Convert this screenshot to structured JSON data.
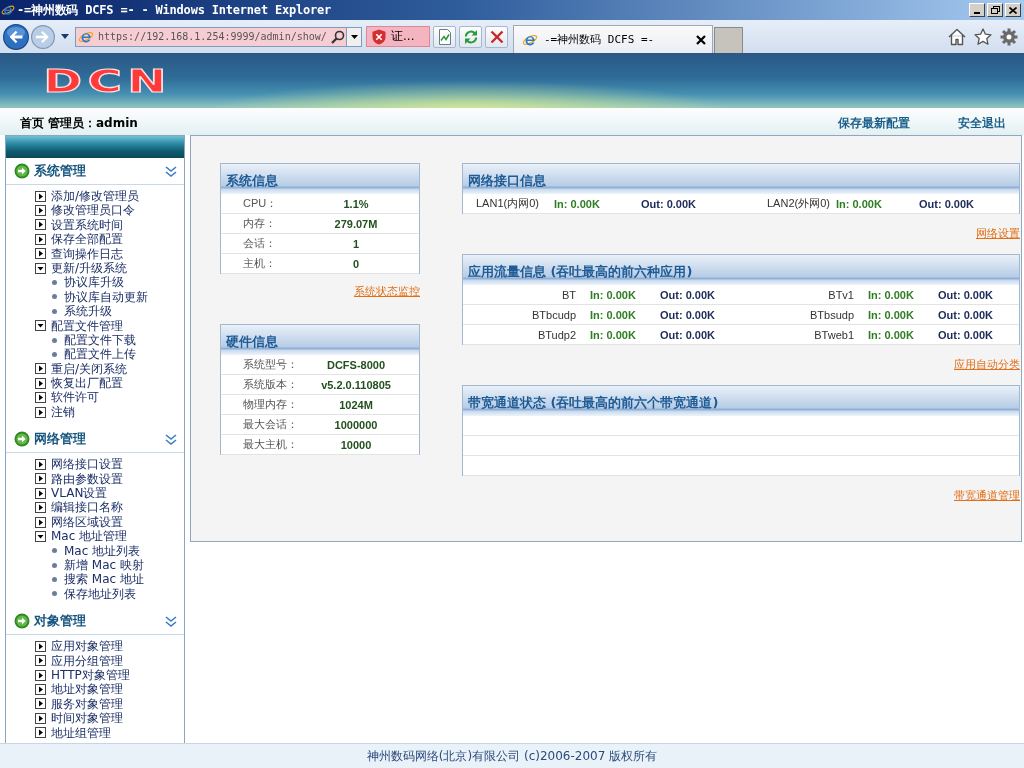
{
  "window": {
    "title": "-=神州数码 DCFS =- - Windows Internet Explorer"
  },
  "browser": {
    "address": "https://192.168.1.254:9999/admin/show/",
    "certificate": "证...",
    "tabs": [
      {
        "label": "-=神州数码 DCFS =-",
        "selected": true
      }
    ]
  },
  "header": {
    "logo": "DCN",
    "home": "首页",
    "admin": "管理员：admin",
    "links": [
      "保存最新配置",
      "安全退出"
    ]
  },
  "sidebar": {
    "sections": [
      {
        "title": "系统管理",
        "items": [
          {
            "label": "添加/修改管理员",
            "expanded": false
          },
          {
            "label": "修改管理员口令",
            "expanded": false
          },
          {
            "label": "设置系统时间",
            "expanded": false
          },
          {
            "label": "保存全部配置",
            "expanded": false
          },
          {
            "label": "查询操作日志",
            "expanded": false
          },
          {
            "label": "更新/升级系统",
            "expanded": true,
            "children": [
              {
                "label": "协议库升级"
              },
              {
                "label": "协议库自动更新"
              },
              {
                "label": "系统升级"
              }
            ]
          },
          {
            "label": "配置文件管理",
            "expanded": true,
            "children": [
              {
                "label": "配置文件下载"
              },
              {
                "label": "配置文件上传"
              }
            ]
          },
          {
            "label": "重启/关闭系统",
            "expanded": false
          },
          {
            "label": "恢复出厂配置",
            "expanded": false
          },
          {
            "label": "软件许可",
            "expanded": false
          },
          {
            "label": "注销",
            "expanded": false
          }
        ]
      },
      {
        "title": "网络管理",
        "items": [
          {
            "label": "网络接口设置",
            "expanded": false
          },
          {
            "label": "路由参数设置",
            "expanded": false
          },
          {
            "label": "VLAN设置",
            "expanded": false
          },
          {
            "label": "编辑接口名称",
            "expanded": false
          },
          {
            "label": "网络区域设置",
            "expanded": false
          },
          {
            "label": "Mac 地址管理",
            "expanded": true,
            "children": [
              {
                "label": "Mac 地址列表"
              },
              {
                "label": "新增 Mac 映射"
              },
              {
                "label": "搜索 Mac 地址"
              },
              {
                "label": "保存地址列表"
              }
            ]
          }
        ]
      },
      {
        "title": "对象管理",
        "items": [
          {
            "label": "应用对象管理",
            "expanded": false
          },
          {
            "label": "应用分组管理",
            "expanded": false
          },
          {
            "label": "HTTP对象管理",
            "expanded": false
          },
          {
            "label": "地址对象管理",
            "expanded": false
          },
          {
            "label": "服务对象管理",
            "expanded": false
          },
          {
            "label": "时间对象管理",
            "expanded": false
          },
          {
            "label": "地址组管理",
            "expanded": false
          }
        ]
      }
    ]
  },
  "main": {
    "left": [
      {
        "title": "系统信息",
        "rows": [
          {
            "label": "CPU：",
            "value": "1.1%"
          },
          {
            "label": "内存：",
            "value": "279.07M"
          },
          {
            "label": "会话：",
            "value": "1"
          },
          {
            "label": "主机：",
            "value": "0"
          }
        ],
        "link": "系统状态监控"
      },
      {
        "title": "硬件信息",
        "rows": [
          {
            "label": "系统型号：",
            "value": "DCFS-8000"
          },
          {
            "label": "系统版本：",
            "value": "v5.2.0.110805"
          },
          {
            "label": "物理内存：",
            "value": "1024M"
          },
          {
            "label": "最大会话：",
            "value": "1000000"
          },
          {
            "label": "最大主机：",
            "value": "10000"
          }
        ]
      }
    ],
    "right": [
      {
        "title": "网络接口信息",
        "kind": "interfaces",
        "rows": [
          {
            "entries": [
              {
                "name": "LAN1(内网0)",
                "in": "In: 0.00K",
                "out": "Out: 0.00K"
              },
              {
                "name": "LAN2(外网0)",
                "in": "In: 0.00K",
                "out": "Out: 0.00K"
              }
            ]
          }
        ],
        "link": "网络设置"
      },
      {
        "title": "应用流量信息 (吞吐最高的前六种应用)",
        "kind": "applications",
        "rows": [
          {
            "entries": [
              {
                "name": "BT",
                "in": "In: 0.00K",
                "out": "Out: 0.00K"
              },
              {
                "name": "BTv1",
                "in": "In: 0.00K",
                "out": "Out: 0.00K"
              }
            ]
          },
          {
            "entries": [
              {
                "name": "BTbcudp",
                "in": "In: 0.00K",
                "out": "Out: 0.00K"
              },
              {
                "name": "BTbsudp",
                "in": "In: 0.00K",
                "out": "Out: 0.00K"
              }
            ]
          },
          {
            "entries": [
              {
                "name": "BTudp2",
                "in": "In: 0.00K",
                "out": "Out: 0.00K"
              },
              {
                "name": "BTweb1",
                "in": "In: 0.00K",
                "out": "Out: 0.00K"
              }
            ]
          }
        ],
        "link": "应用自动分类"
      },
      {
        "title": "带宽通道状态 (吞吐最高的前六个带宽通道)",
        "kind": "channels",
        "link": "带宽通道管理"
      }
    ]
  },
  "footer": "神州数码网络(北京)有限公司 (c)2006-2007 版权所有"
}
